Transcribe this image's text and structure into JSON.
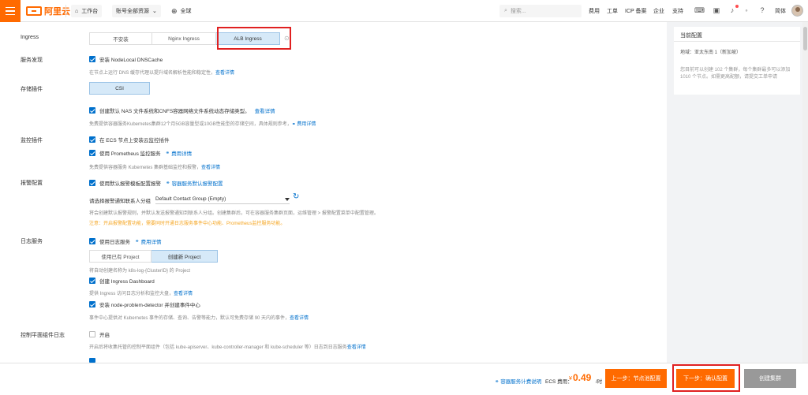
{
  "topbar": {
    "logo_text": "阿里云",
    "workbench": "工作台",
    "account_resources": "账号全部资源",
    "region": "全球",
    "search_placeholder": "搜索...",
    "nav": [
      "费用",
      "工单",
      "ICP 备案",
      "企业",
      "支持"
    ],
    "language": "简体"
  },
  "ingress": {
    "label": "Ingress",
    "options": [
      "不安装",
      "Nginx Ingress",
      "ALB Ingress"
    ],
    "selected": "ALB Ingress"
  },
  "service_discovery": {
    "label": "服务发现",
    "checkbox": "安装 NodeLocal DNSCache",
    "hint": "在节点上运行 DNS 缓存代理以提升域名解析性能和稳定性，",
    "hint_link": "查看详情"
  },
  "storage": {
    "label": "存储插件",
    "option": "CSI",
    "checkbox": "创建默认 NAS 文件系统和CNFS容器网络文件系统动态存储类型。",
    "checkbox_link": "查看详情",
    "hint": "免费提供容器服务Kubernetes集群12个月5GB容量型或10GB性能型的存储空间，具体规则参考，",
    "hint_link": "费用详情"
  },
  "monitoring": {
    "label": "监控插件",
    "checkbox1": "在 ECS 节点上安装云监控插件",
    "checkbox2": "使用 Prometheus 监控服务",
    "checkbox2_link": "费用详情",
    "hint": "免费提供容器服务 Kubernetes 集群基础监控和报警，",
    "hint_link": "查看详情"
  },
  "alerting": {
    "label": "报警配置",
    "checkbox": "使用默认报警模板配置报警",
    "checkbox_link": "容器服务默认报警配置",
    "select_label": "请选择报警通知联系人分组",
    "select_value": "Default Contact Group (Empty)",
    "hint": "将会创建默认报警规则，并默认发送报警通知到联系人分组。创建集群后，可在容器服务集群页面，运维管理 > 报警配置菜单中配置管理。",
    "note": "注意：开启报警配置功能，需要同时开通日志服务事件中心功能、Prometheus监控服务功能。"
  },
  "logging": {
    "label": "日志服务",
    "checkbox": "使用日志服务",
    "checkbox_link": "费用详情",
    "project_options": [
      "使用已有 Project",
      "创建新 Project"
    ],
    "project_selected": "创建新 Project",
    "project_hint": "将自动创建名称为 k8s-log-{ClusterID} 的 Project",
    "dashboard_checkbox": "创建 Ingress Dashboard",
    "dashboard_hint": "提供 Ingress 访问日志分析和监控大盘，",
    "dashboard_link": "查看详情",
    "npd_checkbox": "安装 node-problem-detector 并创建事件中心",
    "npd_hint": "事件中心提供对 Kubernetes 事件的存储、查询、告警等能力，默认可免费存储 90 天内的事件，",
    "npd_link": "查看详情"
  },
  "control_plane_log": {
    "label": "控制平面组件日志",
    "checkbox": "开启",
    "hint": "开启后将收集托管的控制平面组件（包括 kube-apiserver、kube-controller-manager 和 kube-scheduler 等）日志到日志服务",
    "hint_link": "查看详情"
  },
  "right_panel": {
    "title": "当前配置",
    "region": "地域：亚太东南 1（新加坡）",
    "note": "您目前可以创建 102 个集群，每个集群最多可以添加 1010 个节点。如需更高配额，请提交工单申请"
  },
  "footer": {
    "pricing_link": "容器服务计费说明",
    "cost_label": "ECS 费用：",
    "currency": "¥",
    "price": "0.49",
    "unit": "/时",
    "prev_button": "上一步：节点池配置",
    "next_button": "下一步：确认配置",
    "create_button": "创建集群"
  },
  "colors": {
    "brand_orange": "#ff6a00",
    "link_blue": "#0070cc",
    "highlight_red": "#e02020",
    "warning": "#f5a623"
  }
}
